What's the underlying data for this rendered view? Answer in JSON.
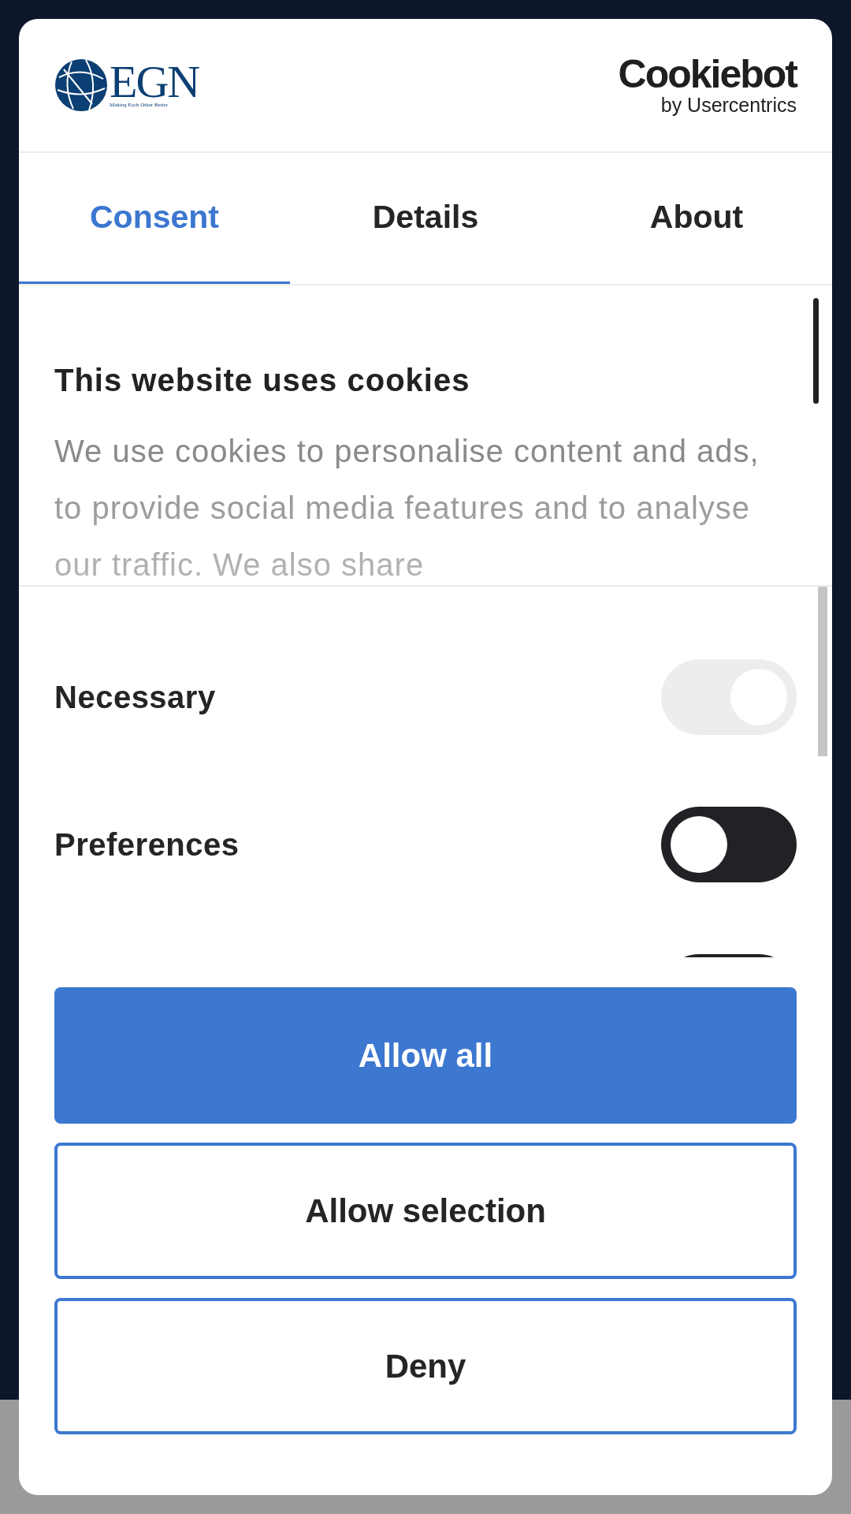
{
  "header": {
    "brand_logo": {
      "name": "EGN",
      "tagline": "Making Each Other Better"
    },
    "provider_logo": {
      "name": "Cookiebot",
      "byline": "by Usercentrics"
    }
  },
  "tabs": [
    {
      "label": "Consent",
      "selected": true
    },
    {
      "label": "Details",
      "selected": false
    },
    {
      "label": "About",
      "selected": false
    }
  ],
  "intro": {
    "title": "This website uses cookies",
    "text": "We use cookies to personalise content and ads, to provide social media features and to analyse our traffic. We also share"
  },
  "categories": [
    {
      "label": "Necessary",
      "on": true,
      "disabled": true
    },
    {
      "label": "Preferences",
      "on": false,
      "disabled": false
    },
    {
      "on": false,
      "disabled": false
    }
  ],
  "buttons": [
    {
      "label": "Allow all",
      "kind": "primary"
    },
    {
      "label": "Allow selection",
      "kind": "outline"
    },
    {
      "label": "Deny",
      "kind": "outline"
    }
  ]
}
